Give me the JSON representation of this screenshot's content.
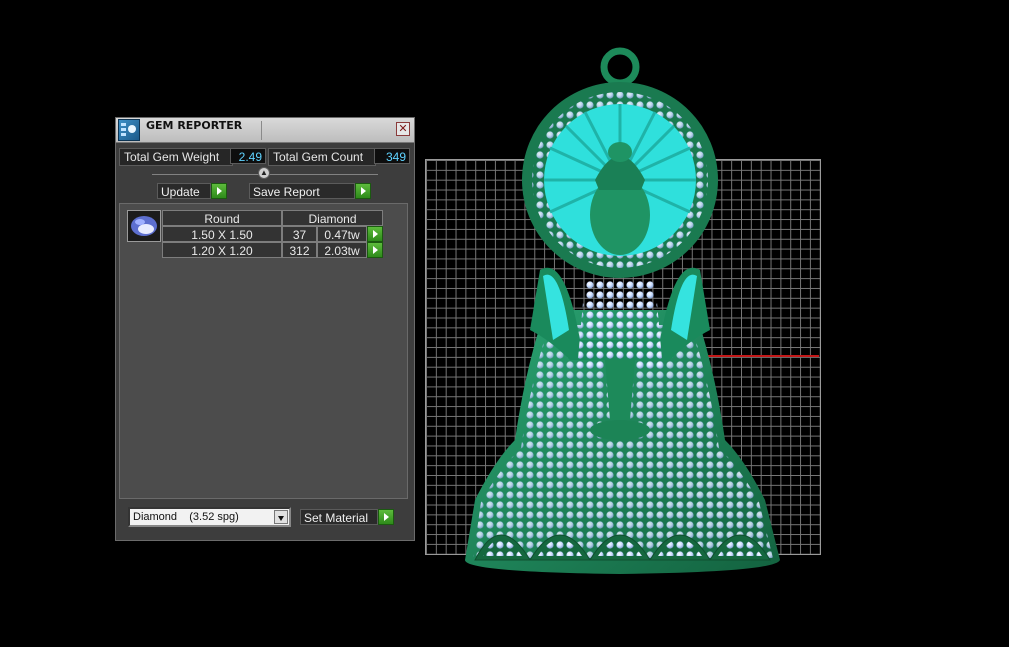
{
  "panel": {
    "title": "GEM REPORTER",
    "close_glyph": "✕",
    "total_weight_label": "Total Gem Weight",
    "total_weight_value": "2.49",
    "total_count_label": "Total Gem Count",
    "total_count_value": "349",
    "update_label": "Update",
    "save_report_label": "Save Report",
    "table": {
      "header_cut": "Round",
      "header_material": "Diamond",
      "rows": [
        {
          "size": "1.50 X 1.50",
          "count": "37",
          "weight": "0.47tw"
        },
        {
          "size": "1.20 X 1.20",
          "count": "312",
          "weight": "2.03tw"
        }
      ]
    },
    "material_select_value": "Diamond    (3.52 spg)",
    "set_material_label": "Set Material"
  },
  "icons": {
    "title": "gem-reporter-icon",
    "collapse": "chevron-up-icon",
    "arrow": "play-arrow-icon",
    "dropdown": "chevron-down-icon"
  },
  "colors": {
    "model_green": "#1d7a52",
    "gem_light": "#c9ddff",
    "gem_cyan": "#31e0dc",
    "value_text": "#5fd3ff",
    "accent_green": "#3fa52a"
  }
}
